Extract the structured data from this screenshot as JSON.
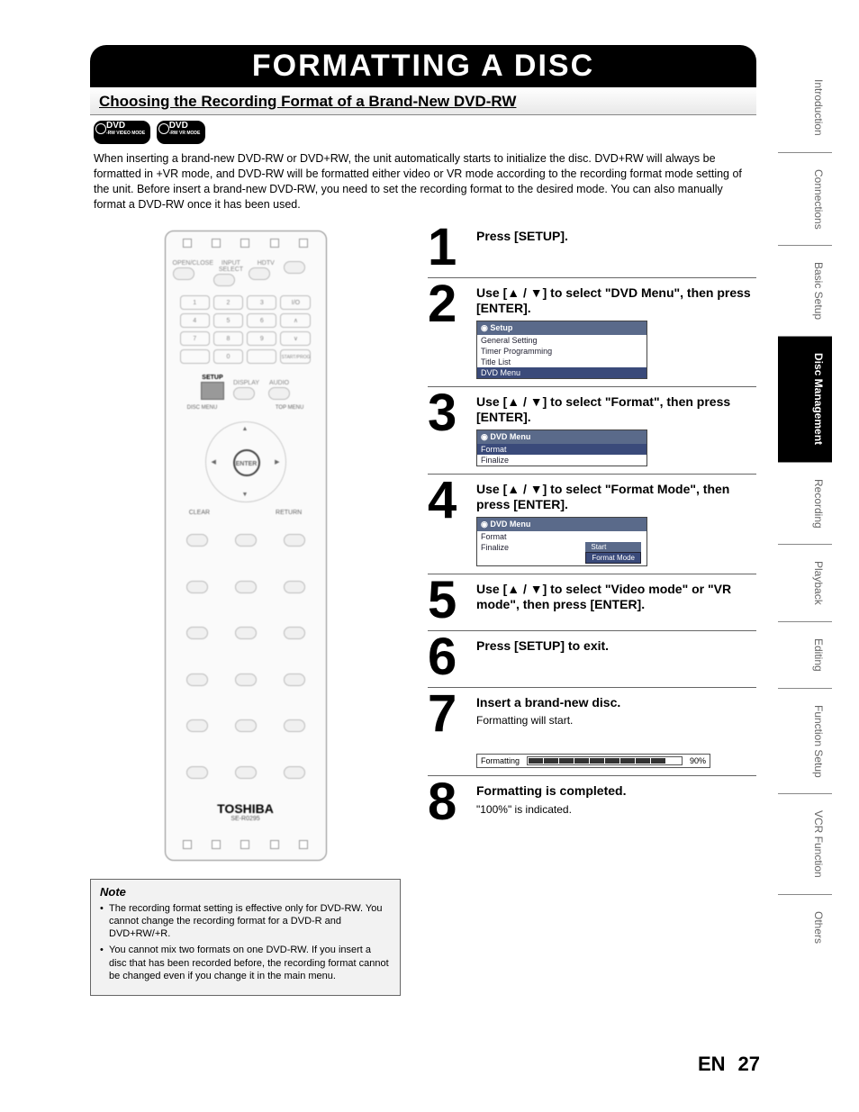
{
  "header": {
    "title": "FORMATTING A DISC",
    "subtitle": "Choosing the Recording Format of a Brand-New DVD-RW"
  },
  "disc_badges": [
    {
      "label": "DVD",
      "sub": "-RW VIDEO MODE"
    },
    {
      "label": "DVD",
      "sub": "-RW VR MODE"
    }
  ],
  "intro_text": "When inserting a brand-new DVD-RW or DVD+RW, the unit automatically starts to initialize the disc. DVD+RW will always be formatted in +VR mode, and DVD-RW will be formatted either video or VR mode according to the recording format mode setting of the unit. Before insert a brand-new DVD-RW, you need to set the recording format to the desired mode. You can also manually format a DVD-RW once it has been used.",
  "remote": {
    "row1_labels": [
      "OPEN/CLOSE",
      "INPUT SELECT",
      "HDTV",
      ""
    ],
    "keypad": [
      "1",
      "2",
      "3",
      "I/O",
      "4",
      "5",
      "6",
      "∧",
      "7",
      "8",
      "9",
      "∨",
      "",
      "0",
      "",
      "START/PROG"
    ],
    "setup_label": "SETUP",
    "display_label": "DISPLAY",
    "audio_label": "AUDIO",
    "disc_menu_label": "DISC MENU",
    "top_menu_label": "TOP MENU",
    "enter_label": "ENTER",
    "clear_label": "CLEAR",
    "return_label": "RETURN",
    "brand": "TOSHIBA",
    "model": "SE-R0295"
  },
  "steps": [
    {
      "num": "1",
      "title": "Press [SETUP].",
      "menu": null
    },
    {
      "num": "2",
      "title": "Use [▲ / ▼] to select \"DVD Menu\", then press [ENTER].",
      "menu": {
        "header": "Setup",
        "items": [
          "General Setting",
          "Timer Programming",
          "Title List",
          "DVD Menu"
        ],
        "sel": 3
      }
    },
    {
      "num": "3",
      "title": "Use [▲ / ▼] to select \"Format\", then press [ENTER].",
      "menu": {
        "header": "DVD Menu",
        "items": [
          "Format",
          "Finalize"
        ],
        "sel": 0
      }
    },
    {
      "num": "4",
      "title": "Use [▲ / ▼] to select \"Format Mode\", then press [ENTER].",
      "menu": {
        "header": "DVD Menu",
        "items": [
          "Format",
          "Finalize"
        ],
        "popup_top": "Start",
        "popup": "Format Mode"
      }
    },
    {
      "num": "5",
      "title": "Use [▲ / ▼] to select \"Video mode\" or \"VR mode\", then press [ENTER].",
      "menu": null
    },
    {
      "num": "6",
      "title": "Press [SETUP] to exit.",
      "menu": null
    },
    {
      "num": "7",
      "title": "Insert a brand-new disc.",
      "sub": "Formatting will start.",
      "progress": {
        "label": "Formatting",
        "percent": "90%"
      }
    },
    {
      "num": "8",
      "title": "Formatting is completed.",
      "sub": "\"100%\" is indicated."
    }
  ],
  "note": {
    "title": "Note",
    "items": [
      "The recording format setting is effective only for DVD-RW. You cannot change the recording format for a DVD-R and DVD+RW/+R.",
      "You cannot mix two formats on one DVD-RW. If you insert a disc that has been recorded before, the recording format cannot be changed even if you change it in the main menu."
    ]
  },
  "side_tabs": [
    {
      "label": "Introduction",
      "active": false
    },
    {
      "label": "Connections",
      "active": false
    },
    {
      "label": "Basic Setup",
      "active": false
    },
    {
      "label": "Disc Management",
      "active": true
    },
    {
      "label": "Recording",
      "active": false
    },
    {
      "label": "Playback",
      "active": false
    },
    {
      "label": "Editing",
      "active": false
    },
    {
      "label": "Function Setup",
      "active": false
    },
    {
      "label": "VCR Function",
      "active": false
    },
    {
      "label": "Others",
      "active": false
    }
  ],
  "footer": {
    "lang": "EN",
    "page": "27"
  }
}
